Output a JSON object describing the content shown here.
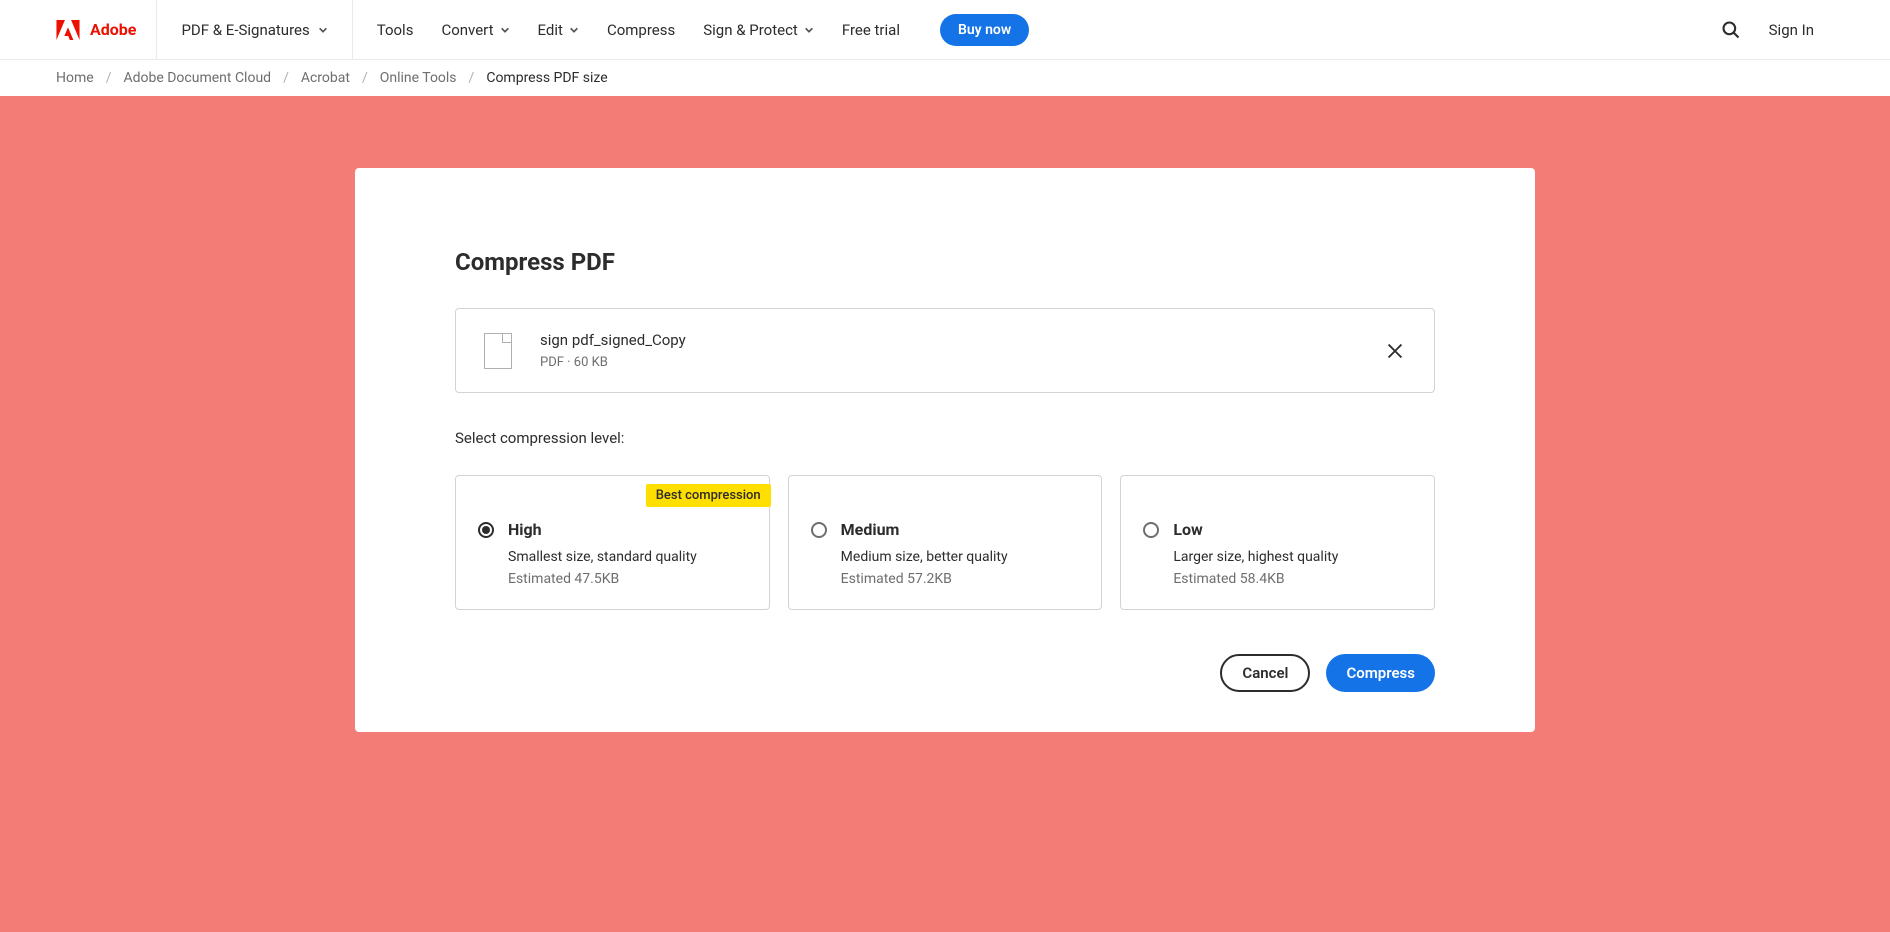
{
  "header": {
    "brand": "Adobe",
    "category": "PDF & E-Signatures",
    "nav": {
      "tools": "Tools",
      "convert": "Convert",
      "edit": "Edit",
      "compress": "Compress",
      "sign_protect": "Sign & Protect",
      "free_trial": "Free trial",
      "buy_now": "Buy now"
    },
    "sign_in": "Sign In"
  },
  "breadcrumb": {
    "home": "Home",
    "adobe_document_cloud": "Adobe Document Cloud",
    "acrobat": "Acrobat",
    "online_tools": "Online Tools",
    "current": "Compress PDF size"
  },
  "page": {
    "title": "Compress PDF",
    "file": {
      "name": "sign pdf_signed_Copy",
      "meta": "PDF · 60 KB"
    },
    "select_label": "Select compression level:",
    "options": [
      {
        "level": "High",
        "desc": "Smallest size, standard quality",
        "estimated": "Estimated 47.5KB",
        "badge": "Best compression",
        "selected": true
      },
      {
        "level": "Medium",
        "desc": "Medium size, better quality",
        "estimated": "Estimated 57.2KB",
        "selected": false
      },
      {
        "level": "Low",
        "desc": "Larger size, highest quality",
        "estimated": "Estimated 58.4KB",
        "selected": false
      }
    ],
    "actions": {
      "cancel": "Cancel",
      "compress": "Compress"
    }
  }
}
